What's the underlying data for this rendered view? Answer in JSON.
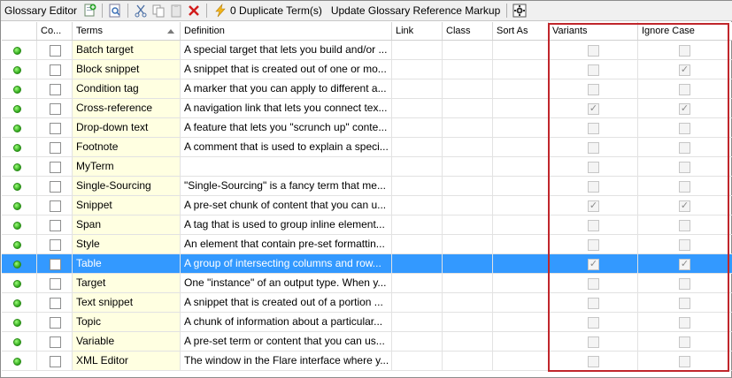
{
  "toolbar": {
    "title": "Glossary Editor",
    "duplicate_label": "0 Duplicate Term(s)",
    "update_label": "Update Glossary Reference Markup"
  },
  "columns": {
    "status": "",
    "co": "Co...",
    "terms": "Terms",
    "definition": "Definition",
    "link": "Link",
    "class": "Class",
    "sort_as": "Sort As",
    "variants": "Variants",
    "ignore_case": "Ignore Case"
  },
  "rows": [
    {
      "term": "Batch target",
      "definition": "A special target that lets you build and/or ...",
      "variants": false,
      "ignore_case": false
    },
    {
      "term": "Block snippet",
      "definition": "A snippet that is created out of one or mo...",
      "variants": false,
      "ignore_case": true
    },
    {
      "term": "Condition tag",
      "definition": "A marker that you can apply to different a...",
      "variants": false,
      "ignore_case": false
    },
    {
      "term": "Cross-reference",
      "definition": "A navigation link that lets you connect tex...",
      "variants": true,
      "ignore_case": true
    },
    {
      "term": "Drop-down text",
      "definition": "A feature that lets you \"scrunch up\" conte...",
      "variants": false,
      "ignore_case": false
    },
    {
      "term": "Footnote",
      "definition": "A comment that is used to explain a speci...",
      "variants": false,
      "ignore_case": false
    },
    {
      "term": "MyTerm",
      "definition": "",
      "variants": false,
      "ignore_case": false
    },
    {
      "term": "Single-Sourcing",
      "definition": "\"Single-Sourcing\" is a fancy term that me...",
      "variants": false,
      "ignore_case": false
    },
    {
      "term": "Snippet",
      "definition": "A pre-set chunk of content that you can u...",
      "variants": true,
      "ignore_case": true
    },
    {
      "term": "Span",
      "definition": "A tag that is used to group inline element...",
      "variants": false,
      "ignore_case": false
    },
    {
      "term": "Style",
      "definition": "An element that contain pre-set formattin...",
      "variants": false,
      "ignore_case": false
    },
    {
      "term": "Table",
      "definition": "A group of intersecting columns and row...",
      "variants": true,
      "ignore_case": true,
      "selected": true
    },
    {
      "term": "Target",
      "definition": "One \"instance\" of an output type. When y...",
      "variants": false,
      "ignore_case": false
    },
    {
      "term": "Text snippet",
      "definition": "A snippet that is created out of a portion ...",
      "variants": false,
      "ignore_case": false
    },
    {
      "term": "Topic",
      "definition": "A chunk of information about a particular...",
      "variants": false,
      "ignore_case": false
    },
    {
      "term": "Variable",
      "definition": "A pre-set term or content that you can us...",
      "variants": false,
      "ignore_case": false
    },
    {
      "term": "XML Editor",
      "definition": "The window in the Flare interface where y...",
      "variants": false,
      "ignore_case": false
    }
  ],
  "colors": {
    "term_background": "#ffffe1",
    "selection": "#3399ff",
    "highlight_box": "#c0262b",
    "status_dot": "#2ea51a"
  },
  "icons": [
    "add-term-icon",
    "preview-icon",
    "cut-icon",
    "copy-icon",
    "paste-icon",
    "delete-icon",
    "lightning-icon",
    "settings-icon"
  ]
}
